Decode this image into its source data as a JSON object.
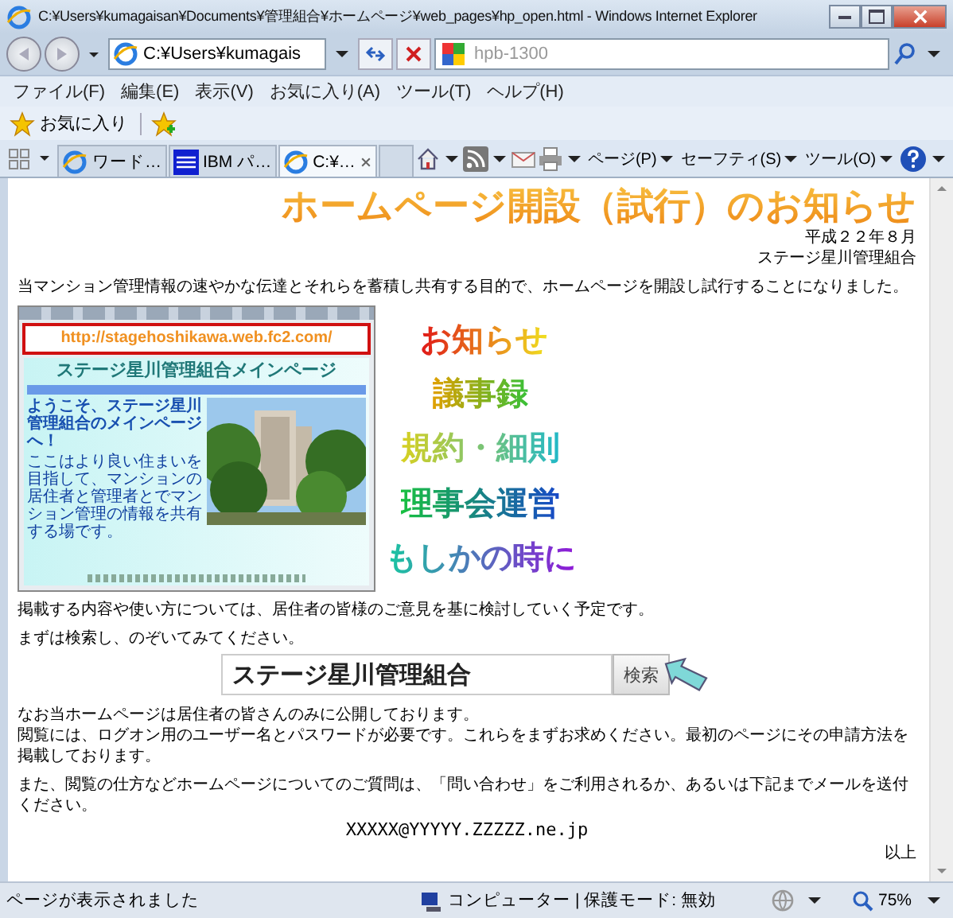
{
  "window": {
    "title": "C:¥Users¥kumagaisan¥Documents¥管理組合¥ホームページ¥web_pages¥hp_open.html - Windows Internet Explorer"
  },
  "address_bar": {
    "value": "C:¥Users¥kumagais",
    "search_placeholder": "hpb-1300"
  },
  "menu_bar": [
    "ファイル(F)",
    "編集(E)",
    "表示(V)",
    "お気に入り(A)",
    "ツール(T)",
    "ヘルプ(H)"
  ],
  "favorites_bar": {
    "label": "お気に入り"
  },
  "tabs": [
    {
      "label": "ワード…",
      "selected": false
    },
    {
      "label": "IBM パ…",
      "selected": false
    },
    {
      "label": "C:¥…",
      "selected": true
    }
  ],
  "command_menus": [
    "ページ(P)",
    "セーフティ(S)",
    "ツール(O)"
  ],
  "page": {
    "heading": "ホームページ開設（試行）のお知らせ",
    "date": "平成２２年８月",
    "organization": "ステージ星川管理組合",
    "intro": "当マンション管理情報の速やかな伝達とそれらを蓄積し共有する目的で、ホームページを開設し試行することになりました。",
    "screenshot": {
      "url": "http://stagehoshikawa.web.fc2.com/",
      "title": "ステージ星川管理組合メインページ",
      "welcome": "ようこそ、ステージ星川管理組合のメインページへ！",
      "description": "ここはより良い住まいを目指して、マンションの居住者と管理者とでマンション管理の情報を共有する場です。"
    },
    "links": [
      "お知らせ",
      "議事録",
      "規約・細則",
      "理事会運営",
      "もしかの時に"
    ],
    "plan": "掲載する内容や使い方については、居住者の皆様のご意見を基に検討していく予定です。",
    "search_prompt": "まずは検索し、のぞいてみてください。",
    "search": {
      "value": "ステージ星川管理組合",
      "button": "検索"
    },
    "notices": [
      "なお当ホームページは居住者の皆さんのみに公開しております。",
      "閲覧には、ログオン用のユーザー名とパスワードが必要です。これらをまずお求めください。最初のページにその申請方法を掲載しております。"
    ],
    "contact": "また、閲覧の仕方などホームページについてのご質問は、「問い合わせ」をご利用されるか、あるいは下記までメールを送付ください。",
    "email": "XXXXX@YYYYY.ZZZZZ.ne.jp",
    "closing": "以上"
  },
  "status_bar": {
    "text": "ページが表示されました",
    "zone": "コンピューター | 保護モード: 無効",
    "zoom": "75%"
  }
}
